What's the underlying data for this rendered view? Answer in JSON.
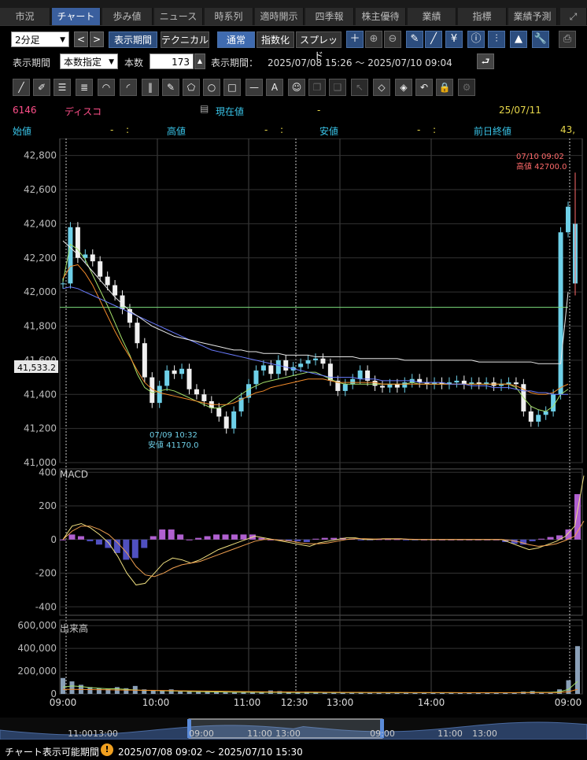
{
  "tabs": [
    {
      "label": "市況",
      "active": false
    },
    {
      "label": "チャート",
      "active": true
    },
    {
      "label": "歩み値",
      "active": false
    },
    {
      "label": "ニュース",
      "active": false
    },
    {
      "label": "時系列",
      "active": false
    },
    {
      "label": "適時開示",
      "active": false
    },
    {
      "label": "四季報",
      "active": false
    },
    {
      "label": "株主優待",
      "active": false
    },
    {
      "label": "業績",
      "active": false
    },
    {
      "label": "指標",
      "active": false
    },
    {
      "label": "業績予測",
      "active": false
    }
  ],
  "toolbar": {
    "interval": "2分足",
    "prev": "<",
    "next": ">",
    "period_button": "表示期間",
    "technical_button": "テクニカル",
    "normal_button": "通常",
    "index_button": "指数化",
    "spread_button": "スプレッド",
    "period_label": "表示期間",
    "period_mode": "本数指定",
    "count_label": "本数",
    "count_value": "173",
    "range_label": "表示期間：",
    "range_value": "2025/07/08 15:26 ～ 2025/07/10 09:04"
  },
  "quote": {
    "code": "6146",
    "name": "ディスコ",
    "current_label": "現在値",
    "current_value": "-",
    "date": "25/07/11",
    "open_label": "始値",
    "open_value": "-",
    "open_time": ":",
    "high_label": "高値",
    "high_value": "-",
    "high_time": ":",
    "low_label": "安値",
    "low_value": "-",
    "low_time": ":",
    "prev_close_label": "前日終値",
    "prev_close_value": "43,"
  },
  "chart_data": [
    {
      "type": "candlestick",
      "title": "",
      "ylim": [
        41000,
        42900
      ],
      "y_ticks": [
        "41,000",
        "41,200",
        "41,400",
        "41,600",
        "41,800",
        "42,000",
        "42,200",
        "42,400",
        "42,600",
        "42,800"
      ],
      "price_marker": "41,533.2",
      "annotations": [
        {
          "time": "07/10 09:02",
          "label": "高値 42700.0"
        },
        {
          "time": "07/09 10:32",
          "label": "安値 41170.0"
        }
      ],
      "series": [
        {
          "name": "close",
          "values": [
            42050,
            42380,
            42200,
            42220,
            42180,
            42090,
            42040,
            41980,
            41900,
            41820,
            41700,
            41500,
            41350,
            41450,
            41540,
            41520,
            41550,
            41430,
            41400,
            41360,
            41320,
            41270,
            41200,
            41300,
            41380,
            41460,
            41540,
            41570,
            41520,
            41600,
            41540,
            41560,
            41580,
            41600,
            41610,
            41580,
            41480,
            41420,
            41460,
            41490,
            41540,
            41480,
            41450,
            41440,
            41460,
            41440,
            41470,
            41490,
            41470,
            41460,
            41470,
            41460,
            41470,
            41480,
            41460,
            41470,
            41460,
            41470,
            41450,
            41460,
            41470,
            41460,
            41300,
            41240,
            41280,
            41300,
            41400,
            42350,
            42500
          ]
        },
        {
          "name": "ma_short",
          "values": [
            42060,
            42280,
            42250,
            42190,
            42100,
            42010,
            41920,
            41820,
            41720,
            41630,
            41520,
            41440,
            41410,
            41420,
            41430,
            41420,
            41400,
            41380,
            41360,
            41340,
            41320,
            41320,
            41340,
            41370,
            41400,
            41430,
            41450,
            41470,
            41480,
            41490,
            41500,
            41510,
            41520,
            41530,
            41530,
            41510,
            41490,
            41470,
            41460,
            41460,
            41460,
            41460,
            41460,
            41460,
            41460,
            41460,
            41460,
            41470,
            41460,
            41460,
            41460,
            41460,
            41460,
            41460,
            41460,
            41460,
            41460,
            41460,
            41460,
            41460,
            41460,
            41440,
            41380,
            41330,
            41310,
            41300,
            41330,
            41400,
            41430
          ]
        },
        {
          "name": "ma_mid",
          "values": [
            42080,
            42150,
            42160,
            42110,
            42040,
            41950,
            41860,
            41770,
            41690,
            41620,
            41540,
            41470,
            41430,
            41410,
            41400,
            41390,
            41380,
            41370,
            41360,
            41350,
            41340,
            41340,
            41340,
            41350,
            41370,
            41390,
            41410,
            41420,
            41440,
            41450,
            41460,
            41470,
            41480,
            41490,
            41490,
            41490,
            41480,
            41470,
            41470,
            41470,
            41470,
            41470,
            41470,
            41460,
            41460,
            41460,
            41460,
            41460,
            41460,
            41460,
            41460,
            41460,
            41460,
            41460,
            41460,
            41460,
            41460,
            41460,
            41460,
            41460,
            41460,
            41450,
            41430,
            41410,
            41400,
            41400,
            41410,
            41440,
            41460
          ]
        },
        {
          "name": "ma_long",
          "values": [
            42020,
            42030,
            42020,
            42000,
            41980,
            41960,
            41940,
            41920,
            41900,
            41880,
            41860,
            41840,
            41820,
            41800,
            41780,
            41760,
            41740,
            41720,
            41700,
            41680,
            41660,
            41650,
            41640,
            41630,
            41620,
            41610,
            41600,
            41590,
            41580,
            41570,
            41560,
            41550,
            41540,
            41530,
            41520,
            41510,
            41500,
            41500,
            41500,
            41500,
            41490,
            41490,
            41490,
            41480,
            41480,
            41480,
            41480,
            41480,
            41470,
            41470,
            41470,
            41470,
            41460,
            41460,
            41460,
            41450,
            41450,
            41450,
            41440,
            41440,
            41440,
            41430,
            41420,
            41420,
            41410,
            41410,
            41400,
            41400,
            41400
          ]
        },
        {
          "name": "ma_xlong",
          "values": [
            42300,
            42260,
            42220,
            42170,
            42120,
            42070,
            42020,
            41970,
            41930,
            41890,
            41860,
            41830,
            41800,
            41780,
            41760,
            41740,
            41730,
            41720,
            41710,
            41700,
            41690,
            41680,
            41670,
            41660,
            41660,
            41650,
            41650,
            41640,
            41640,
            41640,
            41630,
            41630,
            41630,
            41630,
            41620,
            41620,
            41620,
            41620,
            41620,
            41620,
            41610,
            41610,
            41610,
            41610,
            41610,
            41610,
            41600,
            41600,
            41600,
            41600,
            41600,
            41600,
            41600,
            41600,
            41600,
            41600,
            41590,
            41590,
            41590,
            41590,
            41590,
            41590,
            41590,
            41590,
            41580,
            41580,
            41580,
            41580,
            42000
          ]
        },
        {
          "name": "reference_line",
          "values": [
            41910
          ]
        }
      ]
    },
    {
      "type": "line",
      "title": "MACD",
      "ylim": [
        -450,
        420
      ],
      "y_ticks": [
        "400",
        "200",
        "0",
        "-200",
        "-400"
      ],
      "series": [
        {
          "name": "macd",
          "values": [
            0,
            80,
            95,
            70,
            30,
            -20,
            -100,
            -200,
            -270,
            -260,
            -200,
            -140,
            -110,
            -120,
            -140,
            -120,
            -90,
            -60,
            -40,
            -20,
            0,
            20,
            10,
            0,
            -10,
            -20,
            -30,
            -40,
            -20,
            -10,
            0,
            10,
            10,
            0,
            0,
            5,
            5,
            5,
            0,
            0,
            0,
            0,
            0,
            0,
            0,
            0,
            0,
            0,
            0,
            -20,
            -40,
            -60,
            -50,
            -30,
            -10,
            20,
            80,
            380
          ]
        },
        {
          "name": "signal",
          "values": [
            0,
            50,
            80,
            80,
            60,
            30,
            -20,
            -80,
            -160,
            -210,
            -220,
            -200,
            -170,
            -150,
            -140,
            -130,
            -110,
            -90,
            -70,
            -50,
            -30,
            -10,
            0,
            0,
            -5,
            -10,
            -20,
            -25,
            -25,
            -20,
            -10,
            0,
            5,
            5,
            3,
            3,
            3,
            3,
            2,
            1,
            0,
            0,
            0,
            0,
            0,
            0,
            0,
            0,
            0,
            -5,
            -15,
            -30,
            -40,
            -35,
            -25,
            -5,
            20,
            110
          ]
        },
        {
          "name": "histogram",
          "values": [
            0,
            30,
            20,
            -10,
            -30,
            -50,
            -80,
            -120,
            -110,
            -50,
            20,
            60,
            60,
            30,
            0,
            10,
            20,
            30,
            30,
            30,
            30,
            30,
            10,
            0,
            -5,
            -10,
            -10,
            -15,
            5,
            10,
            10,
            10,
            5,
            -5,
            -3,
            2,
            2,
            2,
            -2,
            -1,
            0,
            0,
            0,
            0,
            0,
            0,
            0,
            0,
            0,
            -15,
            -25,
            -30,
            -10,
            5,
            15,
            25,
            60,
            270
          ]
        }
      ]
    },
    {
      "type": "bar",
      "title": "出来高",
      "ylim": [
        0,
        650000
      ],
      "y_ticks": [
        "600,000",
        "400,000",
        "200,000",
        "0"
      ],
      "x_ticks": [
        "09:00",
        "10:00",
        "11:00",
        "12:30",
        "13:00",
        "14:00",
        "09:00"
      ],
      "series": [
        {
          "name": "volume",
          "values": [
            140000,
            110000,
            80000,
            60000,
            50000,
            45000,
            60000,
            50000,
            70000,
            40000,
            35000,
            30000,
            40000,
            30000,
            25000,
            20000,
            25000,
            20000,
            15000,
            15000,
            20000,
            15000,
            20000,
            30000,
            25000,
            15000,
            15000,
            20000,
            15000,
            12000,
            12000,
            12000,
            10000,
            15000,
            12000,
            10000,
            10000,
            12000,
            15000,
            10000,
            12000,
            10000,
            10000,
            8000,
            10000,
            10000,
            8000,
            10000,
            8000,
            10000,
            12000,
            20000,
            25000,
            15000,
            12000,
            40000,
            120000,
            420000
          ]
        },
        {
          "name": "vol_ma_short",
          "values": [
            60000,
            70000,
            65000,
            55000,
            50000,
            45000,
            45000,
            40000,
            35000,
            30000,
            30000,
            28000,
            26000,
            24000,
            22000,
            20000,
            18000,
            17000,
            16000,
            15000,
            15000,
            15000,
            14000,
            14000,
            14000,
            13000,
            13000,
            12000,
            12000,
            12000,
            11000,
            11000,
            11000,
            11000,
            11000,
            11000,
            10000,
            10000,
            10000,
            10000,
            10000,
            10000,
            10000,
            10000,
            10000,
            10000,
            10000,
            10000,
            10000,
            10000,
            10000,
            12000,
            14000,
            14000,
            14000,
            18000,
            40000,
            110000
          ]
        },
        {
          "name": "vol_ma_long",
          "values": [
            40000,
            40000,
            39000,
            38000,
            37000,
            36000,
            35000,
            34000,
            33000,
            32000,
            31000,
            30000,
            29000,
            28000,
            27000,
            26000,
            25000,
            24000,
            23000,
            22000,
            21000,
            20000,
            19000,
            18000,
            18000,
            17000,
            17000,
            16000,
            16000,
            15000,
            15000,
            14000,
            14000,
            14000,
            13000,
            13000,
            13000,
            13000,
            12000,
            12000,
            12000,
            12000,
            12000,
            12000,
            11000,
            11000,
            11000,
            11000,
            11000,
            11000,
            11000,
            11000,
            11000,
            11000,
            11000,
            12000,
            20000,
            40000
          ]
        }
      ]
    }
  ],
  "navigator": {
    "ticks": [
      "11:00",
      "13:00",
      "09:00",
      "11:00",
      "13:00",
      "09:00",
      "11:00",
      "13:00"
    ]
  },
  "footer": {
    "label": "チャート表示可能期間",
    "range": "2025/07/08 09:02 ～ 2025/07/10 15:30"
  },
  "colors": {
    "price_up": "#6ed0e8",
    "price_down": "#f0f0f0",
    "ma_short": "#a4e06a",
    "ma_mid": "#f08a2a",
    "ma_long": "#6a7cff",
    "ma_xlong": "#e8e8e8",
    "reference": "#7ee07e",
    "macd": "#f0e080",
    "signal": "#f0a050",
    "macd_hist_pos": "#b060d0",
    "macd_hist_neg": "#5050c0",
    "volume": "#8aa0b8"
  }
}
